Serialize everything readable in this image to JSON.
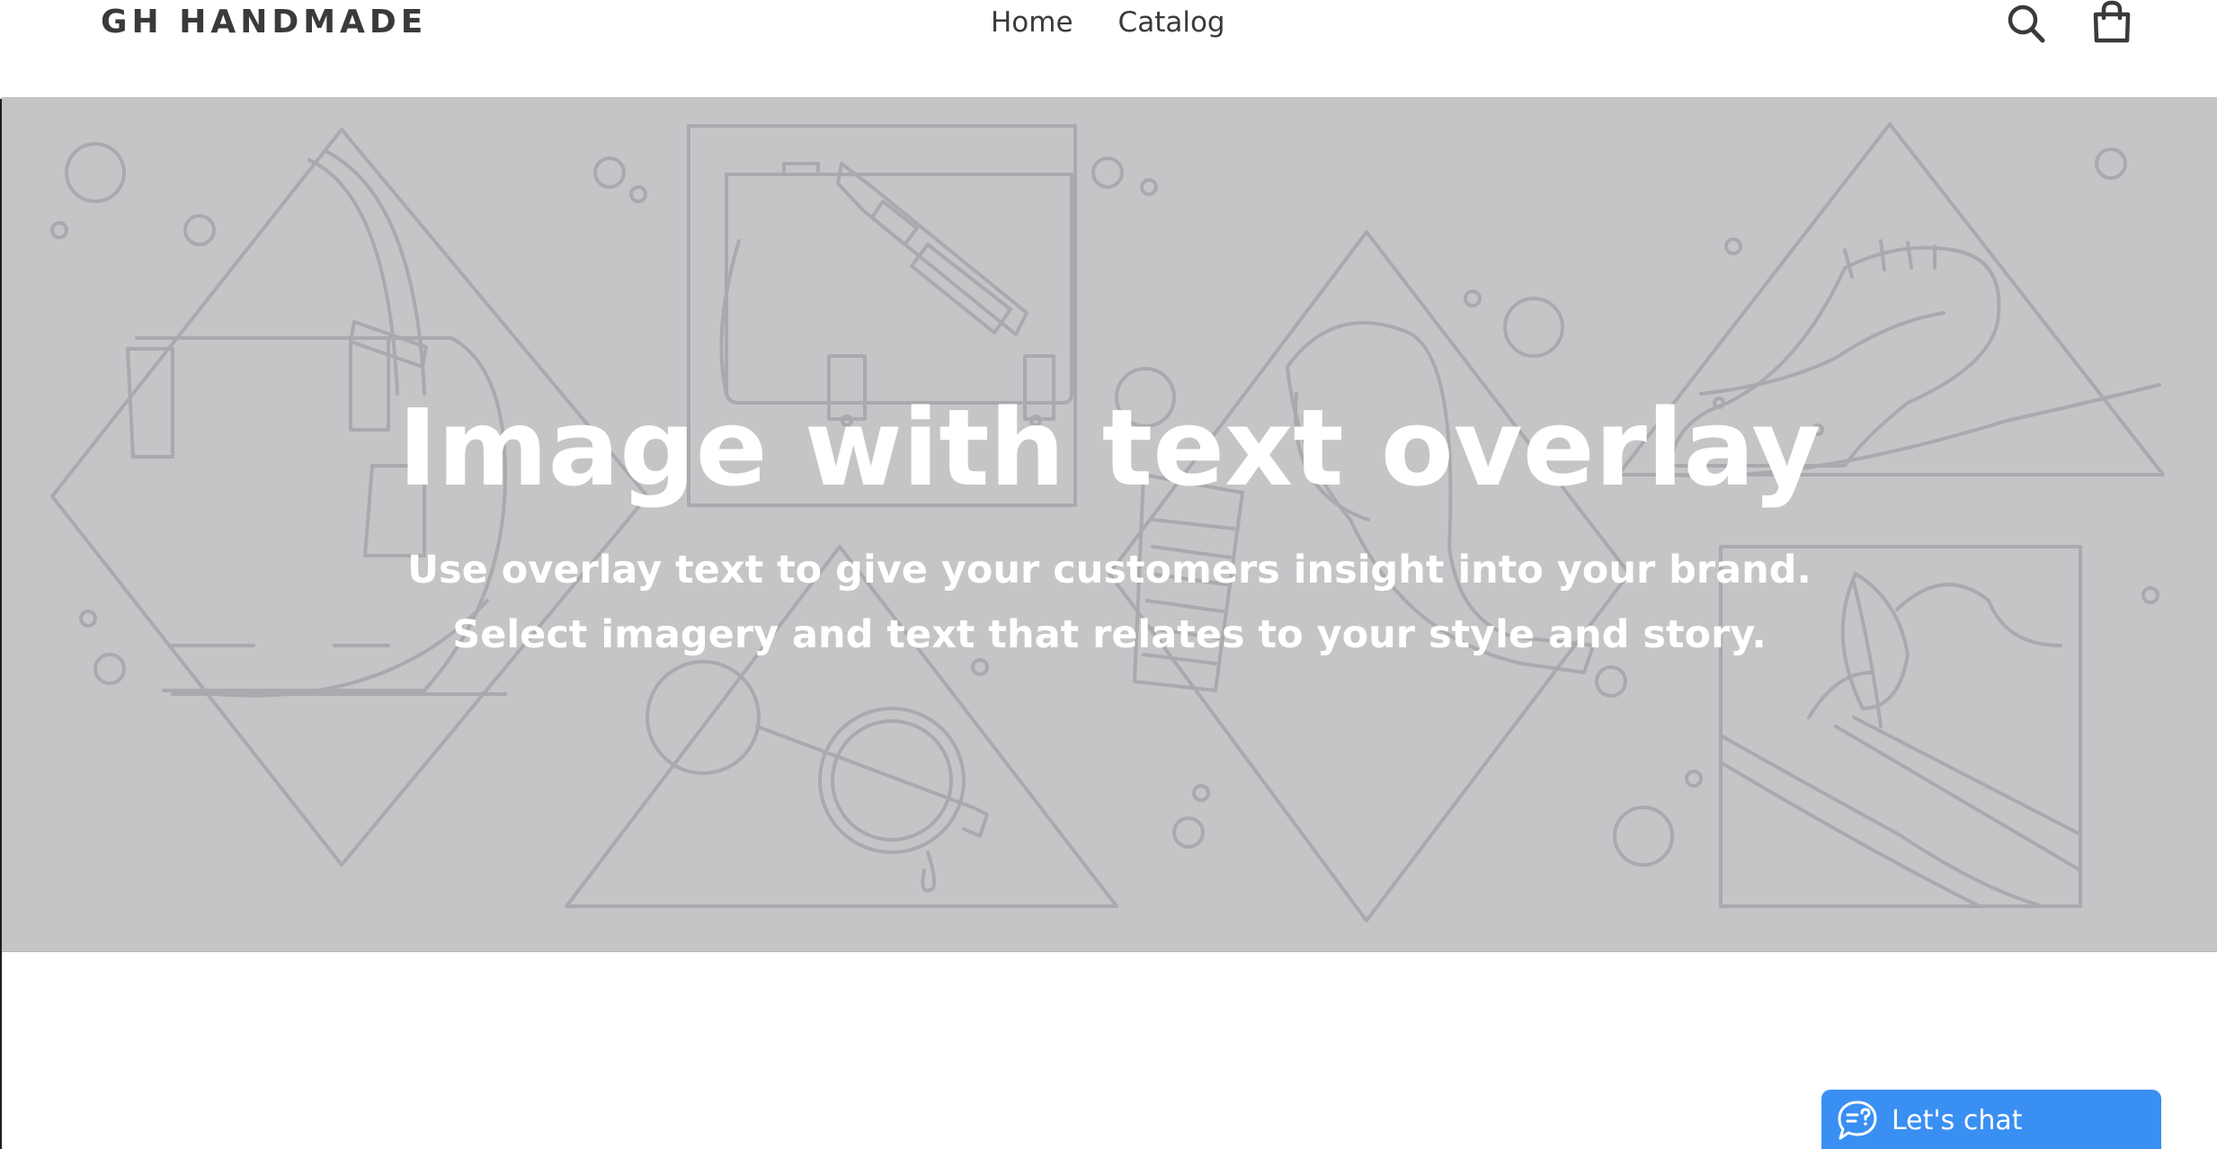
{
  "header": {
    "logo_text": "GH HANDMADE",
    "nav": [
      {
        "label": "Home"
      },
      {
        "label": "Catalog"
      }
    ],
    "icons": {
      "search": "search-icon",
      "cart": "cart-icon"
    }
  },
  "hero": {
    "title": "Image with text overlay",
    "subtitle_line1": "Use overlay text to give your customers insight into your brand.",
    "subtitle_line2": "Select imagery and text that relates to your style and story.",
    "background_color": "#c4c5c7",
    "illustration_color": "#a9aaad"
  },
  "chat": {
    "label": "Let's chat",
    "icon": "chat-bubble-icon",
    "color": "#3a8ff3"
  }
}
